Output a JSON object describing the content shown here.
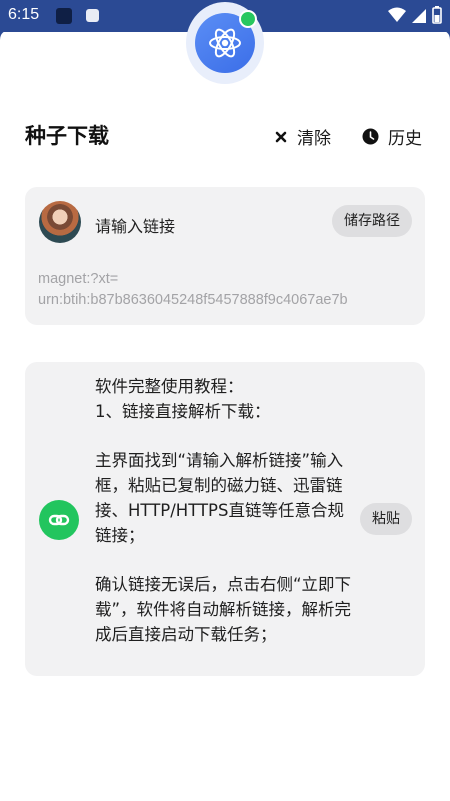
{
  "status_bar": {
    "time": "6:15"
  },
  "header": {
    "title": "种子下载",
    "clear_label": "清除",
    "history_label": "历史"
  },
  "link_card": {
    "input_label": "请输入链接",
    "storage_button": "储存路径",
    "magnet_line1": "magnet:?xt=",
    "magnet_line2": "urn:btih:b87b8636045248f5457888f9c4067ae7b"
  },
  "tutorial_card": {
    "lines": [
      "软件完整使用教程：",
      "1、链接直接解析下载：",
      "主界面找到“请输入解析链接”输入框，粘贴已复制的磁力链、迅雷链接、HTTP/HTTPS直链等任意合规链接；",
      "确认链接无误后，点击右侧“立即下载”，软件将自动解析链接，解析完成后直接启动下载任务；"
    ],
    "paste_button": "粘贴"
  },
  "colors": {
    "status_bar": "#2b4a94",
    "logo_gradient": "#3b6ee8",
    "online_dot": "#27c760",
    "paste_icon": "#22c55e",
    "card_bg": "#f2f2f3"
  }
}
